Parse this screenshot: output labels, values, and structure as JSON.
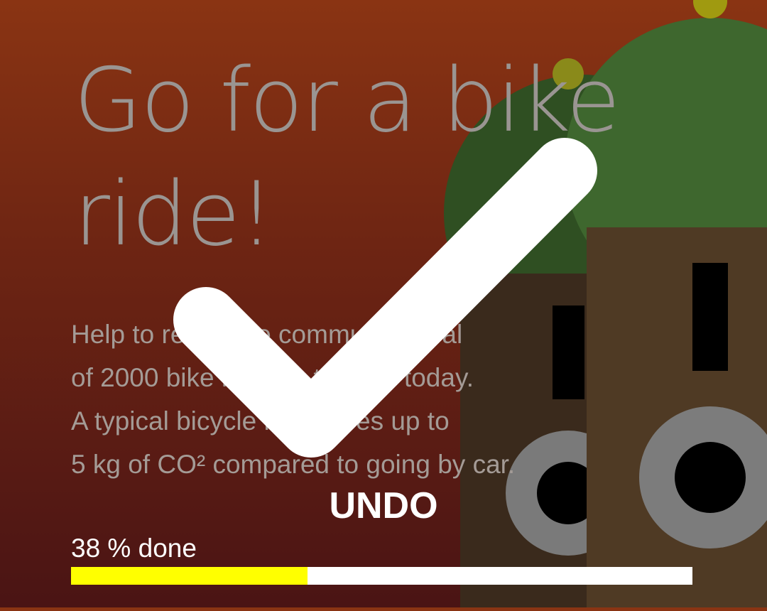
{
  "challenge": {
    "title": "Go for a bike ride!",
    "description_lines": [
      "Help to reach the community goal",
      "of 2000 bike rides in the city today.",
      "A typical bicycle ride saves up to",
      "5 kg of CO² compared to going by car."
    ]
  },
  "actions": {
    "undo_label": "UNDO"
  },
  "progress": {
    "label": "38 % done",
    "value": 0.38
  },
  "colors": {
    "background_top": "#8a3413",
    "background_bottom": "#4a1414",
    "progress_fill": "#ffff00",
    "progress_track": "#ffffff",
    "check": "#ffffff"
  },
  "icons": {
    "overlay": "check-icon"
  }
}
